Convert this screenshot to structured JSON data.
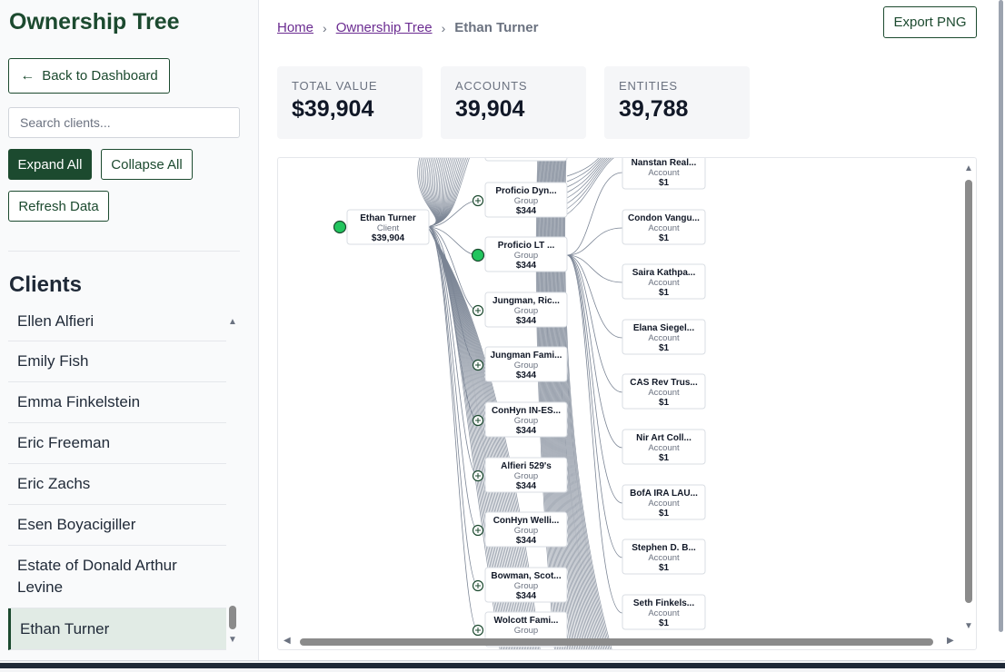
{
  "sidebar": {
    "title": "Ownership Tree",
    "back_label": "Back to Dashboard",
    "search_placeholder": "Search clients...",
    "expand_label": "Expand All",
    "collapse_label": "Collapse All",
    "refresh_label": "Refresh Data",
    "clients_heading": "Clients",
    "clients": [
      "Ellen Alfieri",
      "Emily Fish",
      "Emma Finkelstein",
      "Eric Freeman",
      "Eric Zachs",
      "Esen Boyacigiller",
      "Estate of Donald Arthur Levine",
      "Ethan Turner"
    ],
    "selected_client": "Ethan Turner"
  },
  "breadcrumb": {
    "home": "Home",
    "tree": "Ownership Tree",
    "current": "Ethan Turner"
  },
  "export_label": "Export PNG",
  "stats": {
    "total_value_label": "TOTAL VALUE",
    "total_value": "$39,904",
    "accounts_label": "ACCOUNTS",
    "accounts": "39,904",
    "entities_label": "ENTITIES",
    "entities": "39,788"
  },
  "tree": {
    "root": {
      "name": "Ethan Turner",
      "type": "Client",
      "value": "$39,904"
    },
    "groups": [
      {
        "name": "Proficio Dyn...",
        "type": "Group",
        "value": "$344",
        "expanded": false
      },
      {
        "name": "Proficio LT ...",
        "type": "Group",
        "value": "$344",
        "expanded": true
      },
      {
        "name": "Jungman, Ric...",
        "type": "Group",
        "value": "$344",
        "expanded": false
      },
      {
        "name": "Jungman Fami...",
        "type": "Group",
        "value": "$344",
        "expanded": false
      },
      {
        "name": "ConHyn IN-ES...",
        "type": "Group",
        "value": "$344",
        "expanded": false
      },
      {
        "name": "Alfieri 529's",
        "type": "Group",
        "value": "$344",
        "expanded": false
      },
      {
        "name": "ConHyn Welli...",
        "type": "Group",
        "value": "$344",
        "expanded": false
      },
      {
        "name": "Bowman, Scot...",
        "type": "Group",
        "value": "$344",
        "expanded": false
      },
      {
        "name": "Wolcott Fami...",
        "type": "Group",
        "value": "",
        "expanded": false
      }
    ],
    "accounts": [
      {
        "name": "Nanstan Real...",
        "type": "Account",
        "value": "$1"
      },
      {
        "name": "Condon Vangu...",
        "type": "Account",
        "value": "$1"
      },
      {
        "name": "Saira Kathpa...",
        "type": "Account",
        "value": "$1"
      },
      {
        "name": "Elana Siegel...",
        "type": "Account",
        "value": "$1"
      },
      {
        "name": "CAS Rev Trus...",
        "type": "Account",
        "value": "$1"
      },
      {
        "name": "Nir Art Coll...",
        "type": "Account",
        "value": "$1"
      },
      {
        "name": "BofA IRA LAU...",
        "type": "Account",
        "value": "$1"
      },
      {
        "name": "Stephen D. B...",
        "type": "Account",
        "value": "$1"
      },
      {
        "name": "Seth Finkels...",
        "type": "Account",
        "value": "$1"
      }
    ],
    "colors": {
      "link": "#7b8595",
      "expanded_toggle": "#22c55e",
      "collapsed_toggle": "#1c4a2f",
      "brand": "#1c4a2f"
    }
  }
}
